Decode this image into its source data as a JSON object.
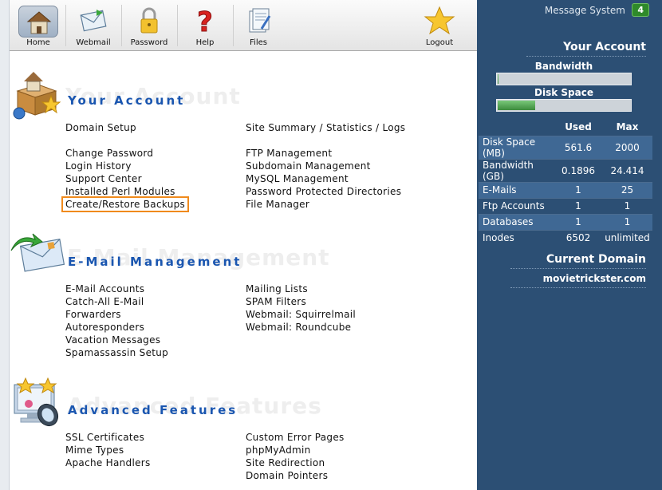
{
  "toolbar": {
    "home": "Home",
    "webmail": "Webmail",
    "password": "Password",
    "help": "Help",
    "files": "Files",
    "logout": "Logout"
  },
  "panel": {
    "message_system": "Message System",
    "message_count": "4",
    "title": "Your Account",
    "bandwidth_label": "Bandwidth",
    "disk_label": "Disk Space",
    "bandwidth_usage": 0.008,
    "disk_usage": 0.28,
    "col_used": "Used",
    "col_max": "Max",
    "rows": [
      {
        "label": "Disk Space (MB)",
        "used": "561.6",
        "max": "2000"
      },
      {
        "label": "Bandwidth (GB)",
        "used": "0.1896",
        "max": "24.414"
      },
      {
        "label": "E-Mails",
        "used": "1",
        "max": "25"
      },
      {
        "label": "Ftp Accounts",
        "used": "1",
        "max": "1"
      },
      {
        "label": "Databases",
        "used": "1",
        "max": "1"
      },
      {
        "label": "Inodes",
        "used": "6502",
        "max": "unlimited"
      }
    ],
    "current_domain_title": "Current Domain",
    "current_domain": "movietrickster.com"
  },
  "sections": {
    "account": {
      "title": "Your Account",
      "ghost": "Your Account",
      "left": [
        "Domain Setup",
        "Change Password",
        "Login History",
        "Support Center",
        "Installed Perl Modules",
        "Create/Restore Backups"
      ],
      "right": [
        "Site Summary / Statistics / Logs",
        "FTP Management",
        "Subdomain Management",
        "MySQL Management",
        "Password Protected Directories",
        "File Manager"
      ]
    },
    "email": {
      "title": "E-Mail Management",
      "ghost": "E-Mail Management",
      "left": [
        "E-Mail Accounts",
        "Catch-All E-Mail",
        "Forwarders",
        "Autoresponders",
        "Vacation Messages",
        "Spamassassin Setup"
      ],
      "right": [
        "Mailing Lists",
        "SPAM Filters",
        "Webmail: Squirrelmail",
        "Webmail: Roundcube"
      ]
    },
    "advanced": {
      "title": "Advanced Features",
      "ghost": "Advanced Features",
      "left": [
        "SSL Certificates",
        "Mime Types",
        "Apache Handlers"
      ],
      "right": [
        "Custom Error Pages",
        "phpMyAdmin",
        "Site Redirection",
        "Domain Pointers"
      ]
    }
  },
  "colors": {
    "panel_bg": "#2c4f74",
    "section_title": "#1a56b0",
    "highlight": "#f08a1c"
  },
  "icons": {
    "home": "house-icon",
    "webmail": "envelope-icon",
    "password": "padlock-icon",
    "help": "question-mark-icon",
    "files": "files-icon",
    "logout": "star-icon"
  }
}
